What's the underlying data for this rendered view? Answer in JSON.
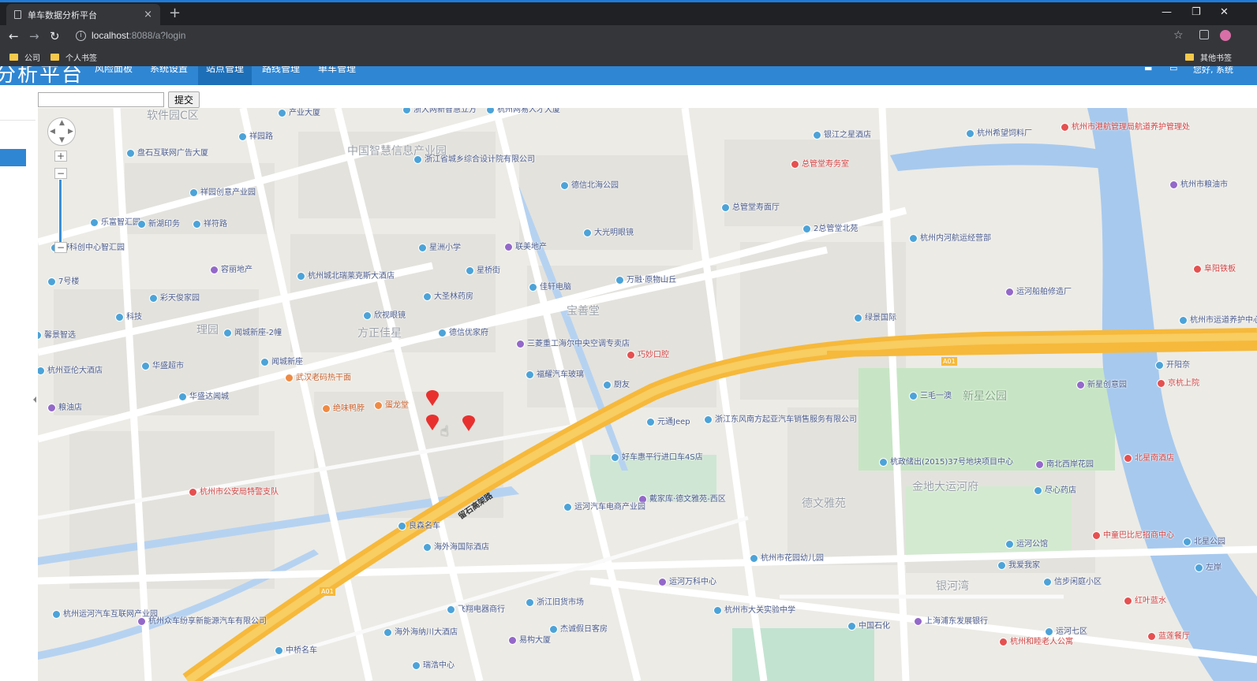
{
  "browser": {
    "tab_title": "单车数据分析平台",
    "url_host": "localhost",
    "url_rest": ":8088/a?login",
    "bookmarks": [
      "公司",
      "个人书签"
    ],
    "other_bookmarks": "其他书签"
  },
  "app": {
    "brand": "分析平台",
    "nav": [
      "风险面板",
      "系统设置",
      "站点管理",
      "路线管理",
      "单车管理"
    ],
    "active_nav_index": 2,
    "nav_right": "您好, 系统",
    "accent": "#2f86d3"
  },
  "search": {
    "value": "",
    "submit_label": "提交"
  },
  "map": {
    "road_name": "留石高架路",
    "highway_badge": "A01",
    "park_label": "新星公园",
    "labels": [
      {
        "t": "软件园C区",
        "c": "big"
      },
      {
        "t": "产业大厦"
      },
      {
        "t": "浙大网新智慧立方"
      },
      {
        "t": "杭州网易人才大厦"
      },
      {
        "t": "祥园路"
      },
      {
        "t": "中国智慧信息产业园",
        "c": "big"
      },
      {
        "t": "浙江省城乡综合设计院有限公司"
      },
      {
        "t": "德信北海公园"
      },
      {
        "t": "银江之星酒店"
      },
      {
        "t": "杭州希望饲料厂"
      },
      {
        "t": "杭州市港航管理局航道养护管理处",
        "c": "red"
      },
      {
        "t": "盘石互联网广告大厦"
      },
      {
        "t": "祥园创意产业园"
      },
      {
        "t": "总管堂寿务室",
        "c": "red"
      },
      {
        "t": "总管堂寿面厅"
      },
      {
        "t": "杭州市粮油市"
      },
      {
        "t": "乐富智汇园"
      },
      {
        "t": "新湖印务"
      },
      {
        "t": "祥符路"
      },
      {
        "t": "星洲小学"
      },
      {
        "t": "联美地产"
      },
      {
        "t": "大光明眼镜"
      },
      {
        "t": "2总管堂北苑"
      },
      {
        "t": "杭州内河航运经营部"
      },
      {
        "t": "野科创中心智汇园"
      },
      {
        "t": "容丽地产"
      },
      {
        "t": "杭州城北瑞莱克斯大酒店"
      },
      {
        "t": "星桥街"
      },
      {
        "t": "佳轩电脑"
      },
      {
        "t": "万融·原物山丘"
      },
      {
        "t": "阜阳铁板",
        "c": "red"
      },
      {
        "t": "7号楼"
      },
      {
        "t": "彩天俊家园"
      },
      {
        "t": "大圣林药房"
      },
      {
        "t": "宝善堂",
        "c": "big"
      },
      {
        "t": "运河船舶修造厂"
      },
      {
        "t": "科技"
      },
      {
        "t": "欣视眼镜"
      },
      {
        "t": "绿景国际"
      },
      {
        "t": "馨景智选"
      },
      {
        "t": "理园",
        "c": "big"
      },
      {
        "t": "闻城新座-2幢"
      },
      {
        "t": "方正佳星",
        "c": "big"
      },
      {
        "t": "德信优家府"
      },
      {
        "t": "杭州市运道养护中心"
      },
      {
        "t": "三菱重工海尔中央空调专卖店"
      },
      {
        "t": "巧妙口腔",
        "c": "red"
      },
      {
        "t": "闻城新座"
      },
      {
        "t": "杭州亚伦大酒店"
      },
      {
        "t": "华盛超市"
      },
      {
        "t": "武汉老码热干面",
        "c": "orange"
      },
      {
        "t": "福耀汽车玻璃"
      },
      {
        "t": "厨友"
      },
      {
        "t": "开阳奈"
      },
      {
        "t": "京杭上院",
        "c": "red"
      },
      {
        "t": "粮油店"
      },
      {
        "t": "华盛达闻城"
      },
      {
        "t": "绝味鸭脖",
        "c": "orange"
      },
      {
        "t": "蛋龙堂",
        "c": "orange"
      },
      {
        "t": "三毛一澳"
      },
      {
        "t": "新星创意园"
      },
      {
        "t": "元通Jeep"
      },
      {
        "t": "浙江东风南方起亚汽车销售服务有限公司"
      },
      {
        "t": "好车惠平行进口车4S店"
      },
      {
        "t": "杭政储出(2015)37号地块项目中心"
      },
      {
        "t": "南北西岸花园"
      },
      {
        "t": "北星南酒店",
        "c": "red"
      },
      {
        "t": "杭州市公安局特警支队",
        "c": "red"
      },
      {
        "t": "金地大运河府",
        "c": "big"
      },
      {
        "t": "尽心药店"
      },
      {
        "t": "戴家库·德文雅苑-西区"
      },
      {
        "t": "德文雅苑",
        "c": "big"
      },
      {
        "t": "运河汽车电商产业园"
      },
      {
        "t": "良森名车"
      },
      {
        "t": "运河公馆"
      },
      {
        "t": "中童巴比尼招商中心",
        "c": "red"
      },
      {
        "t": "北星公园"
      },
      {
        "t": "海外海国际酒店"
      },
      {
        "t": "我爱我家"
      },
      {
        "t": "杭州市花园幼儿园"
      },
      {
        "t": "运河万科中心"
      },
      {
        "t": "银河湾",
        "c": "big"
      },
      {
        "t": "信步闲庭小区"
      },
      {
        "t": "红叶蓝水",
        "c": "red"
      },
      {
        "t": "杭州运河汽车互联网产业园"
      },
      {
        "t": "杭州众车纷享新能源汽车有限公司"
      },
      {
        "t": "飞翔电器商行"
      },
      {
        "t": "浙江旧货市场"
      },
      {
        "t": "杭州市大关实验中学"
      },
      {
        "t": "中国石化"
      },
      {
        "t": "上海浦东发展银行"
      },
      {
        "t": "运河七区"
      },
      {
        "t": "蓝莲餐厅",
        "c": "red"
      },
      {
        "t": "杰诚假日客房"
      },
      {
        "t": "海外海纳川大酒店"
      },
      {
        "t": "易构大厦"
      },
      {
        "t": "杭州和睦老人公寓",
        "c": "red"
      },
      {
        "t": "中桥名车"
      },
      {
        "t": "瑞浩中心"
      },
      {
        "t": "左岸"
      }
    ],
    "marker_count": 3
  }
}
